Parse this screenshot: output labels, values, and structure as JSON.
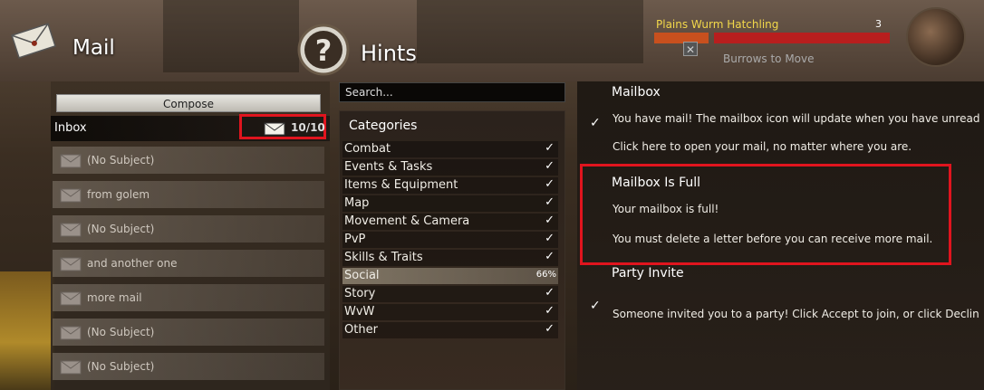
{
  "mail": {
    "title": "Mail",
    "compose_label": "Compose",
    "inbox_label": "Inbox",
    "inbox_count": "10/10",
    "messages": [
      {
        "subject": "(No Subject)"
      },
      {
        "subject": "from golem"
      },
      {
        "subject": "(No Subject)"
      },
      {
        "subject": "and another one"
      },
      {
        "subject": "more mail"
      },
      {
        "subject": "(No Subject)"
      },
      {
        "subject": "(No Subject)"
      }
    ]
  },
  "hints": {
    "title": "Hints",
    "search_placeholder": "Search...",
    "categories_header": "Categories",
    "categories": [
      {
        "label": "Combat",
        "status": "✓"
      },
      {
        "label": "Events & Tasks",
        "status": "✓"
      },
      {
        "label": "Items & Equipment",
        "status": "✓"
      },
      {
        "label": "Map",
        "status": "✓"
      },
      {
        "label": "Movement & Camera",
        "status": "✓"
      },
      {
        "label": "PvP",
        "status": "✓"
      },
      {
        "label": "Skills & Traits",
        "status": "✓"
      },
      {
        "label": "Social",
        "status": "66%"
      },
      {
        "label": "Story",
        "status": "✓"
      },
      {
        "label": "WvW",
        "status": "✓"
      },
      {
        "label": "Other",
        "status": "✓"
      }
    ],
    "details": [
      {
        "title": "Mailbox",
        "check": "✓",
        "text1": "You have mail! The mailbox icon will update when you have unread m",
        "text2": "Click here to open your mail, no matter where you are."
      },
      {
        "title": "Mailbox Is Full",
        "text1": "Your mailbox is full!",
        "text2": "You must delete a letter before you can receive more mail."
      },
      {
        "title": "Party Invite",
        "check": "✓",
        "text1": "Someone invited you to a party! Click Accept to join, or click Declin"
      }
    ]
  },
  "target": {
    "name": "Plains Wurm Hatchling",
    "level": "3",
    "sub_label": "Burrows to Move",
    "close_glyph": "✕"
  },
  "colors": {
    "highlight": "#e0141e",
    "target_name": "#f2d84a",
    "health_bar": "#b81e1e"
  }
}
